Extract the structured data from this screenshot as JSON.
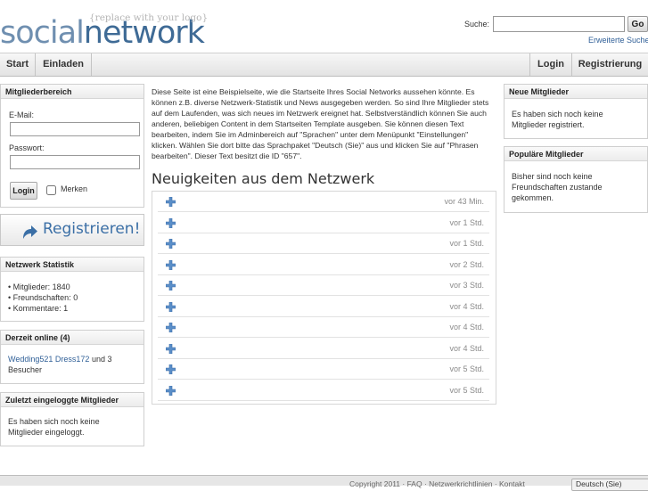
{
  "header": {
    "logo_part1": "social",
    "logo_part2": "network",
    "logo_tagline": "{replace with your logo}",
    "search_label": "Suche:",
    "search_value": "",
    "go_label": "Go",
    "advanced_search": "Erweiterte Suche"
  },
  "nav": {
    "left": [
      "Start",
      "Einladen"
    ],
    "right": [
      "Login",
      "Registrierung"
    ]
  },
  "login_box": {
    "title": "Mitgliederbereich",
    "email_label": "E-Mail:",
    "email_value": "",
    "password_label": "Passwort:",
    "password_value": "",
    "login_button": "Login",
    "remember_label": "Merken"
  },
  "register_banner": "Registrieren!",
  "stats_box": {
    "title": "Netzwerk Statistik",
    "items": [
      "• Mitglieder: 1840",
      "• Freundschaften: 0",
      "• Kommentare: 1"
    ]
  },
  "online_box": {
    "title": "Derzeit online (4)",
    "user1": "Wedding521",
    "user2": "Dress172",
    "suffix": "und 3 Besucher"
  },
  "last_login_box": {
    "title": "Zuletzt eingeloggte Mitglieder",
    "text": "Es haben sich noch keine Mitglieder eingeloggt."
  },
  "main": {
    "intro": "Diese Seite ist eine Beispielseite, wie die Startseite Ihres Social Networks aussehen könnte. Es können z.B. diverse Netzwerk-Statistik und News ausgegeben werden. So sind Ihre Mitglieder stets auf dem Laufenden, was sich neues im Netzwerk ereignet hat. Selbstverständlich können Sie auch anderen, beliebigen Content in dem Startseiten Template ausgeben. Sie können diesen Text bearbeiten, indem Sie im Adminbereich auf \"Sprachen\" unter dem Menüpunkt \"Einstellungen\" klicken. Wählen Sie dort bitte das Sprachpaket \"Deutsch (Sie)\" aus und klicken Sie auf \"Phrasen bearbeiten\". Dieser Text besitzt die ID \"657\".",
    "news_title": "Neuigkeiten aus dem Netzwerk",
    "news": [
      {
        "time": "vor 43 Min."
      },
      {
        "time": "vor 1 Std."
      },
      {
        "time": "vor 1 Std."
      },
      {
        "time": "vor 2 Std."
      },
      {
        "time": "vor 3 Std."
      },
      {
        "time": "vor 4 Std."
      },
      {
        "time": "vor 4 Std."
      },
      {
        "time": "vor 4 Std."
      },
      {
        "time": "vor 5 Std."
      },
      {
        "time": "vor 5 Std."
      }
    ]
  },
  "new_members_box": {
    "title": "Neue Mitglieder",
    "text": "Es haben sich noch keine Mitglieder registriert."
  },
  "popular_box": {
    "title": "Populäre Mitglieder",
    "text": "Bisher sind noch keine Freundschaften zustande gekommen."
  },
  "footer": {
    "text": "Copyright 2011 · FAQ · Netzwerkrichtlinien · Kontakt",
    "language_select": "Deutsch (Sie)"
  },
  "icons": {
    "news_item": "plus-icon",
    "register": "arrow-icon"
  }
}
